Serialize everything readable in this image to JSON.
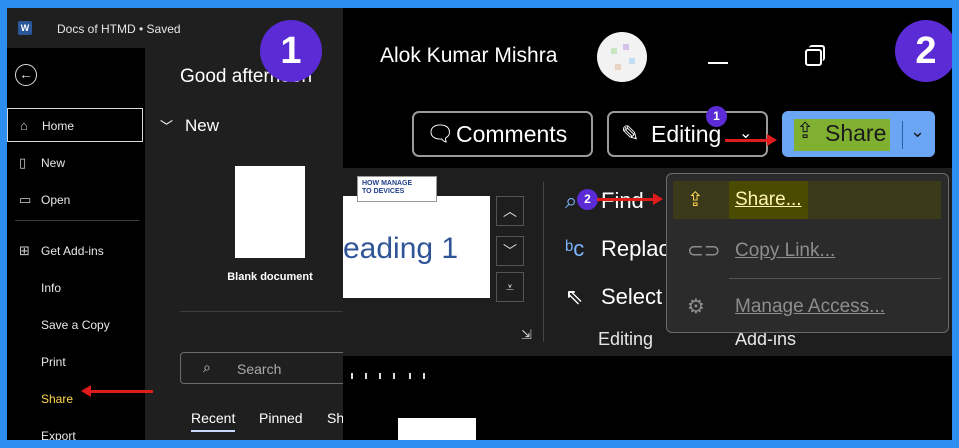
{
  "left": {
    "title_bar": {
      "app_icon": "word-icon",
      "app_letter": "W",
      "doc_title": "Docs of HTMD • Saved"
    },
    "badge": "1",
    "nav": {
      "back_icon": "back-arrow-icon",
      "items": [
        {
          "label": "Home",
          "icon": "home-icon"
        },
        {
          "label": "New",
          "icon": "new-doc-icon"
        },
        {
          "label": "Open",
          "icon": "folder-icon"
        },
        {
          "label": "Get Add-ins",
          "icon": "grid-icon"
        },
        {
          "label": "Info"
        },
        {
          "label": "Save a Copy"
        },
        {
          "label": "Print"
        },
        {
          "label": "Share"
        },
        {
          "label": "Export"
        }
      ]
    },
    "content": {
      "greeting": "Good afternoon",
      "new_section": "New",
      "blank_document": "Blank document",
      "search_placeholder": "Search",
      "tabs": [
        "Recent",
        "Pinned",
        "Sha"
      ]
    }
  },
  "right": {
    "badge": "2",
    "user_name": "Alok Kumar Mishra",
    "buttons": {
      "comments": "Comments",
      "editing": "Editing",
      "share": "Share"
    },
    "ribbon": {
      "style_preview": "eading 1",
      "logo_text": {
        "line1": "HOW",
        "line2": "TO",
        "line3": "MANAGE",
        "line4": "DEVICES"
      },
      "editing_items": [
        "Find",
        "Replac",
        "Select"
      ],
      "group_labels": {
        "editing": "Editing",
        "addins": "Add-ins"
      }
    },
    "share_menu": {
      "items": [
        {
          "label": "Share...",
          "icon": "share-icon",
          "highlighted": true
        },
        {
          "label": "Copy Link...",
          "icon": "link-icon",
          "disabled": true
        },
        {
          "label": "Manage Access...",
          "icon": "gear-icon",
          "disabled": true
        }
      ]
    },
    "step_badges": [
      "1",
      "2"
    ]
  },
  "colors": {
    "border": "#2b8ef0",
    "badge": "#5b2bd5",
    "arrow": "#e01b1b",
    "share_button": "#6ba6f5",
    "highlight": "#7fb02f",
    "share_label": "#ffd54f"
  }
}
